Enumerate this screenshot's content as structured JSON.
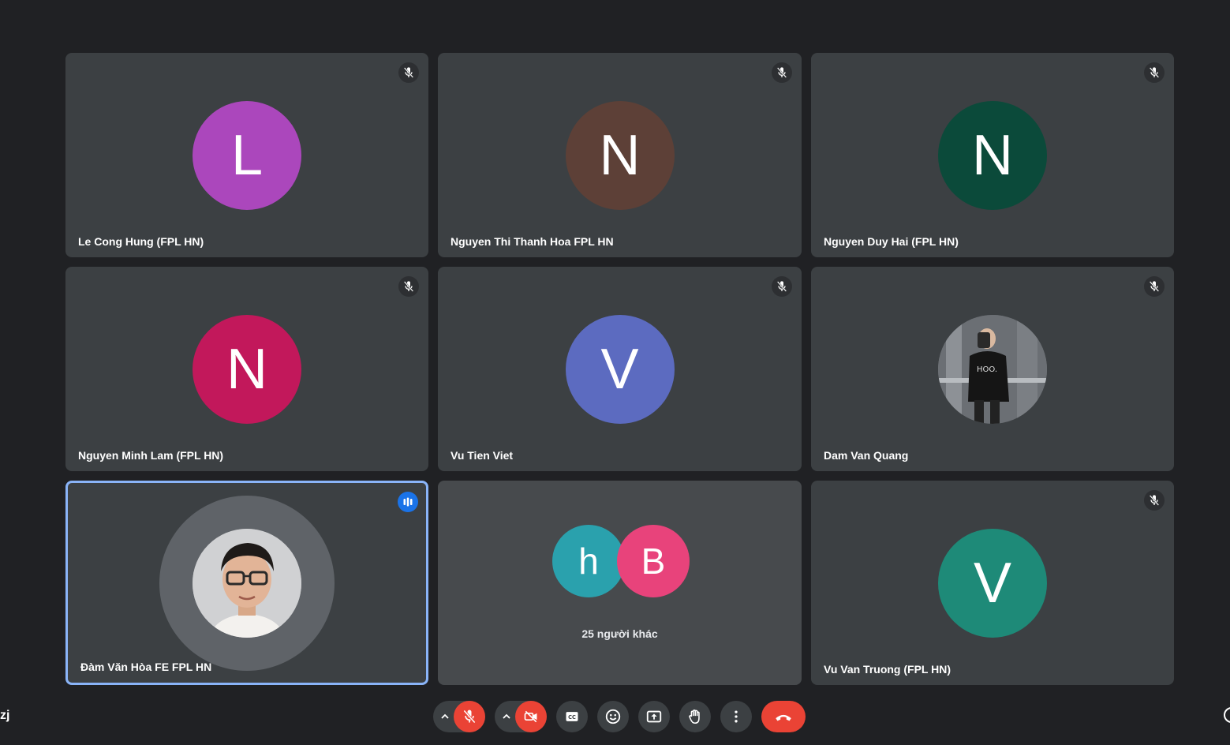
{
  "participants": [
    {
      "name": "Le Cong Hung (FPL HN)",
      "initial": "L",
      "color": "#ab47bc"
    },
    {
      "name": "Nguyen Thi Thanh Hoa FPL HN",
      "initial": "N",
      "color": "#5d4037"
    },
    {
      "name": "Nguyen Duy Hai (FPL HN)",
      "initial": "N",
      "color": "#0b4a3a"
    },
    {
      "name": "Nguyen Minh Lam (FPL HN)",
      "initial": "N",
      "color": "#c2185b"
    },
    {
      "name": "Vu Tien Viet",
      "initial": "V",
      "color": "#5c6bc0"
    },
    {
      "name": "Dam Van Quang"
    },
    {
      "name": "Đàm Văn Hòa FE FPL HN"
    },
    {
      "name": "Vu Van Truong (FPL HN)",
      "initial": "V",
      "color": "#1e8a78"
    }
  ],
  "others": {
    "label": "25 người khác",
    "avatars": [
      {
        "initial": "h",
        "color": "#2aa1ad"
      },
      {
        "initial": "B",
        "color": "#e8437b"
      }
    ]
  },
  "bottom": {
    "left_partial_text": "zj"
  },
  "colors": {
    "background": "#202124",
    "tile": "#3c4043",
    "active_border": "#8ab4f8",
    "danger": "#ea4335",
    "speaking": "#1a73e8"
  },
  "icons": {
    "mic": "mic-off-icon",
    "camera": "camera-off-icon",
    "captions": "closed-captions-icon",
    "reactions": "emoji-icon",
    "present": "present-screen-icon",
    "hand": "raise-hand-icon",
    "more": "more-options-icon",
    "leave": "end-call-icon"
  }
}
